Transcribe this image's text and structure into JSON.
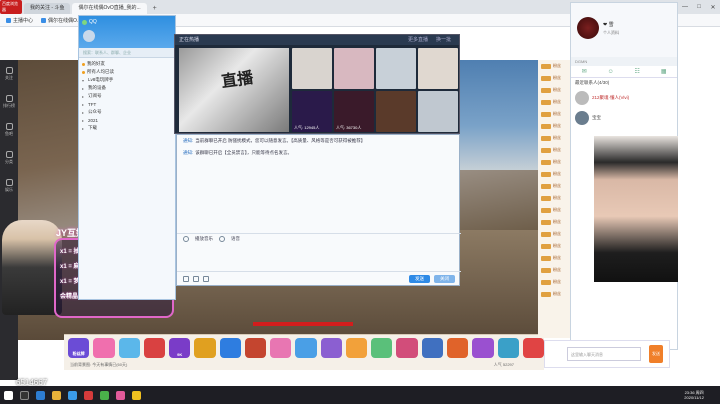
{
  "browser": {
    "logo": "百度浏览器",
    "tabs": [
      "我的关注 - 斗鱼",
      "偶尔在线偶OvO直播_我的..."
    ],
    "new_tab": "+",
    "win_ctrls": [
      "—",
      "□",
      "✕"
    ],
    "bookmarks": [
      "主播中心",
      "偶尔在线偶O..."
    ]
  },
  "site_sidebar": [
    "关注",
    "排行榜",
    "鱼吧",
    "分类",
    "娱乐"
  ],
  "stream_overlay": {
    "title": "JY互娱",
    "lines": [
      "x1 = 抽日天/情侣",
      "x1 = 麻雀一周车位",
      "x1 = 梦想",
      "会精晶计/粉丝榜前十=永久上车"
    ],
    "counter": "6514667"
  },
  "qq_contacts": {
    "title": "QQ",
    "search_hint": "搜索：联系人、群聊、企业",
    "sections": [
      "我的好友",
      "Lv8电玩牌手",
      "我的设备",
      "订阅号",
      "TFT",
      "公众号",
      "2021",
      "下载"
    ],
    "groups_note": "所有人均已读"
  },
  "live_hall": {
    "title": "正在热播",
    "links": [
      "更多直播",
      "换一批"
    ],
    "feature_text": "直播",
    "cells": [
      {
        "viewers": ""
      },
      {
        "viewers": ""
      },
      {
        "viewers": ""
      },
      {
        "viewers": ""
      },
      {
        "viewers": "人气: 12945人"
      },
      {
        "viewers": "人气: 36730人"
      },
      {
        "viewers": ""
      },
      {
        "viewers": ""
      }
    ]
  },
  "chat": {
    "messages": [
      {
        "tag": "通知:",
        "text": "当前群聊已开启 防骚扰模式，您可以随意发言。【高质量、风格等是否可获得被推荐】"
      },
      {
        "tag": "通知:",
        "text": "该群聊已开启【全员禁言】，只能等待点名发言。"
      }
    ],
    "toolbar": [
      "播放音乐",
      "语音"
    ],
    "send_label": "发送",
    "close_label": "关闭"
  },
  "right_chat": [
    "粉丝",
    "粉丝",
    "粉丝",
    "粉丝",
    "粉丝",
    "粉丝",
    "粉丝",
    "粉丝",
    "粉丝",
    "粉丝",
    "粉丝",
    "粉丝",
    "粉丝",
    "粉丝",
    "粉丝",
    "粉丝",
    "粉丝",
    "粉丝",
    "粉丝",
    "粉丝"
  ],
  "qq_profile": {
    "name": "❤ 雪",
    "sign": "个人资料",
    "search_hint": "DGMN",
    "section": "最近联系人(4/30)",
    "items": [
      {
        "name": "212聚魂·懂人(Vivi)"
      },
      {
        "name": "宝宝"
      }
    ]
  },
  "gift_bar": {
    "gifts": [
      "粉丝牌",
      "",
      "",
      "",
      "9K",
      "",
      "",
      "",
      "",
      "",
      "",
      "",
      "",
      "",
      "",
      "",
      "",
      "",
      ""
    ],
    "colors": [
      "#6b4cd6",
      "#f06fae",
      "#5bb7ea",
      "#d94141",
      "#7a3cc8",
      "#e0a020",
      "#2e7de0",
      "#c4452f",
      "#e876b2",
      "#4a9fe6",
      "#8b5fd1",
      "#f2a13a",
      "#5ac07a",
      "#d24d7a",
      "#4070c0",
      "#e0632a",
      "#9a50d0",
      "#3aa0c8",
      "#e04444"
    ],
    "info_left": "当前背景图: 今天有事情已(60天)",
    "info_right": "人气 52297"
  },
  "rp_bottom": {
    "input_hint": "这里输入聊天消息",
    "send": "发送"
  },
  "taskbar": {
    "time": "23:36 周四",
    "date": "2020/11/12"
  }
}
